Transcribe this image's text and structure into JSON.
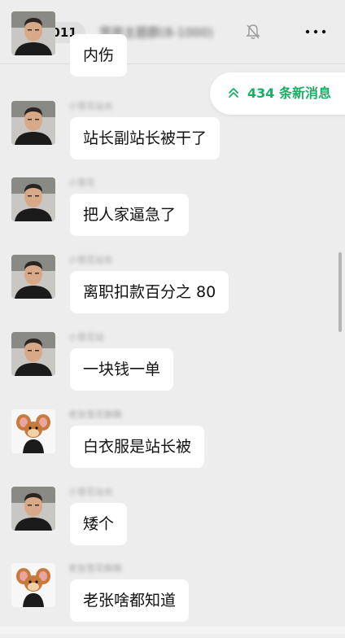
{
  "header": {
    "back_icon": "chevron-left-icon",
    "unread_count": "1011",
    "chat_title": "雪原主题群(8-1000)",
    "mute_icon": "bell-off-icon",
    "more_icon": "more-dots-icon"
  },
  "new_messages": {
    "icon": "double-chevron-up-icon",
    "label": "434 条新消息",
    "color": "#1aad65"
  },
  "messages": [
    {
      "sender": "",
      "avatar": "man-photo-avatar",
      "text": "内伤"
    },
    {
      "sender": "小雪花站长",
      "avatar": "man-photo-avatar",
      "text": "站长副站长被干了"
    },
    {
      "sender": "小雪花",
      "avatar": "man-photo-avatar",
      "text": "把人家逼急了"
    },
    {
      "sender": "小雪花站长",
      "avatar": "man-photo-avatar",
      "text": "离职扣款百分之 80"
    },
    {
      "sender": "小雪花站",
      "avatar": "man-photo-avatar",
      "text": "一块钱一单"
    },
    {
      "sender": "老张雪花飘飘",
      "avatar": "cartoon-mouse-avatar",
      "text": "白衣服是站长被"
    },
    {
      "sender": "小雪花站长",
      "avatar": "man-photo-avatar",
      "text": "矮个"
    },
    {
      "sender": "老张雪花飘飘",
      "avatar": "cartoon-mouse-avatar",
      "text": "老张啥都知道"
    }
  ]
}
